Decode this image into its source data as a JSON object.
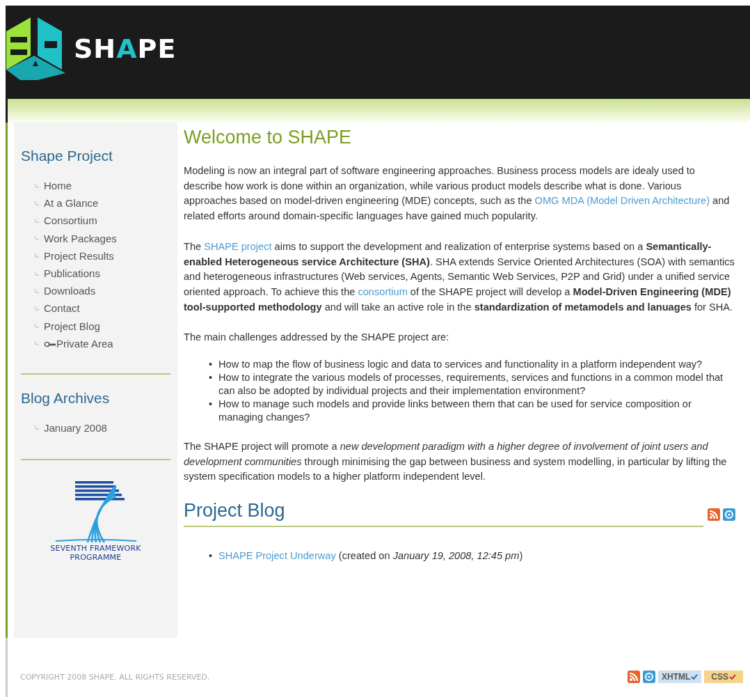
{
  "header": {
    "logo_parts": [
      {
        "text": "SH",
        "accent": false
      },
      {
        "text": "A",
        "accent": true
      },
      {
        "text": "PE",
        "accent": false
      }
    ]
  },
  "sidebar": {
    "sections": [
      {
        "title": "Shape Project",
        "items": [
          {
            "label": "Home",
            "kind": "plain"
          },
          {
            "label": "At a Glance",
            "kind": "plain"
          },
          {
            "label": "Consortium",
            "kind": "plain"
          },
          {
            "label": "Work Packages",
            "kind": "plain"
          },
          {
            "label": "Project Results",
            "kind": "plain"
          },
          {
            "label": "Publications",
            "kind": "plain"
          },
          {
            "label": "Downloads",
            "kind": "plain"
          },
          {
            "label": "Contact",
            "kind": "plain"
          },
          {
            "label": "Project Blog",
            "kind": "plain"
          },
          {
            "label": "Private Area",
            "kind": "key"
          }
        ]
      },
      {
        "title": "Blog Archives",
        "items": [
          {
            "label": "January 2008",
            "kind": "plain"
          }
        ]
      }
    ],
    "programme_logo": {
      "line1": "SEVENTH FRAMEWORK",
      "line2": "PROGRAMME"
    }
  },
  "main": {
    "title": "Welcome to SHAPE",
    "paragraphs": [
      {
        "kind": "text",
        "segments": [
          {
            "kind": "text",
            "text": "Modeling is now an integral part of software engineering approaches. Business process models are idealy used to describe how work is done within an organization, while various product models describe what is done. Various approaches based on model-driven engineering (MDE) concepts, such as the "
          },
          {
            "kind": "link",
            "text": "OMG MDA (Model Driven Architecture)"
          },
          {
            "kind": "text",
            "text": " and related efforts around domain-specific languages have gained much popularity."
          }
        ]
      },
      {
        "kind": "text",
        "segments": [
          {
            "kind": "text",
            "text": "The "
          },
          {
            "kind": "link",
            "text": "SHAPE project"
          },
          {
            "kind": "text",
            "text": " aims to support the development and realization of enterprise systems based on a "
          },
          {
            "kind": "bold",
            "text": "Semantically-enabled Heterogeneous service Architecture (SHA)"
          },
          {
            "kind": "text",
            "text": ". SHA extends Service Oriented Architectures (SOA) with semantics and heterogeneous infrastructures (Web services, Agents, Semantic Web Services, P2P and Grid) under a unified service oriented approach. To achieve this the "
          },
          {
            "kind": "link",
            "text": "consortium"
          },
          {
            "kind": "text",
            "text": " of the SHAPE project will develop a "
          },
          {
            "kind": "bold",
            "text": "Model-Driven Engineering (MDE) tool-supported methodology"
          },
          {
            "kind": "text",
            "text": " and will take an active role in the "
          },
          {
            "kind": "bold",
            "text": "standardization of metamodels and lanuages"
          },
          {
            "kind": "text",
            "text": " for SHA."
          }
        ]
      },
      {
        "kind": "text",
        "segments": [
          {
            "kind": "text",
            "text": "The main challenges addressed by the SHAPE project are:"
          }
        ]
      },
      {
        "kind": "bullets",
        "marker": "•",
        "items": [
          "How to map the flow of business logic and data to services and functionality in a platform independent way?",
          "How to integrate the various models of processes, requirements, services and functions in a common model that can also be adopted by individual projects and their implementation environment?",
          "How to manage such models and provide links between them that can be used for service composition or managing changes?"
        ]
      },
      {
        "kind": "text",
        "segments": [
          {
            "kind": "text",
            "text": "The SHAPE project will promote a "
          },
          {
            "kind": "italic",
            "text": "new development paradigm with a higher degree of involvement of joint users and development communities"
          },
          {
            "kind": "text",
            "text": " through minimising the gap between business and system modelling, in particular by lifting the system specification models to a higher platform independent level."
          }
        ]
      }
    ],
    "blog": {
      "title": "Project Blog",
      "posts": [
        {
          "marker": "•",
          "link": "SHAPE Project Underway",
          "before": "(created on ",
          "date": "January 19, 2008, 12:45 pm",
          "after": ")"
        }
      ]
    }
  },
  "footer": {
    "copyright": "COPYRIGHT 2008 SHAPE. ALL RIGHTS RESERVED.",
    "badges": [
      {
        "text": "XHTML",
        "kind": "xhtml"
      },
      {
        "text": "CSS",
        "kind": "css"
      }
    ]
  }
}
